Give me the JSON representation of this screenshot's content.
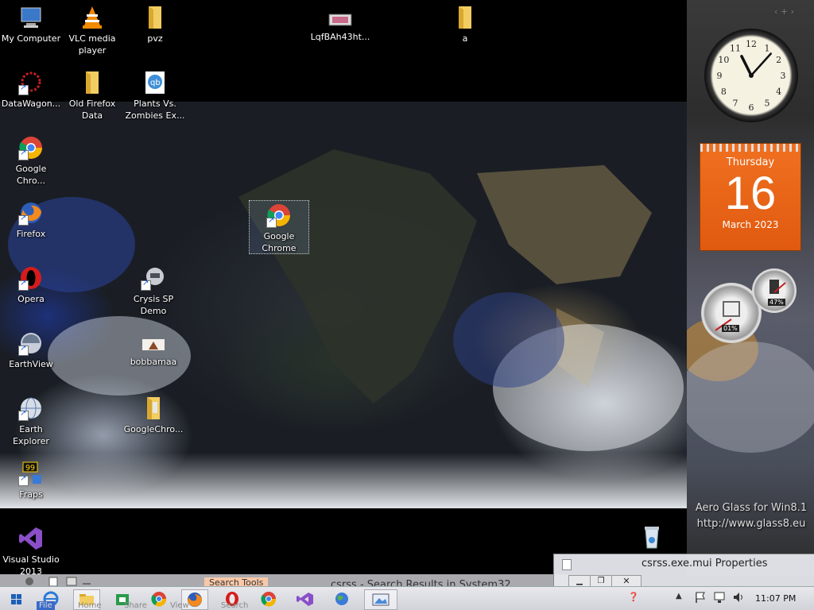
{
  "desktop_icons": [
    {
      "label": "My Computer",
      "icon": "computer-icon"
    },
    {
      "label": "VLC media player",
      "icon": "vlc-icon"
    },
    {
      "label": "pvz",
      "icon": "folder-icon"
    },
    {
      "label": "LqfBAh43ht...",
      "icon": "image-file-icon"
    },
    {
      "label": "a",
      "icon": "folder-icon"
    },
    {
      "label": "DataWagon...",
      "icon": "app-icon"
    },
    {
      "label": "Old Firefox Data",
      "icon": "folder-icon"
    },
    {
      "label": "Plants Vs. Zombies Ex...",
      "icon": "qbittorrent-icon"
    },
    {
      "label": "Google Chro...",
      "icon": "chrome-icon"
    },
    {
      "label": "Firefox",
      "icon": "firefox-icon"
    },
    {
      "label": "Opera",
      "icon": "opera-icon"
    },
    {
      "label": "EarthView",
      "icon": "earthview-icon"
    },
    {
      "label": "Earth Explorer",
      "icon": "earth-explorer-icon"
    },
    {
      "label": "Fraps",
      "icon": "fraps-icon"
    },
    {
      "label": "Visual Studio 2013",
      "icon": "visual-studio-icon"
    },
    {
      "label": "Google Chrome",
      "icon": "chrome-icon"
    },
    {
      "label": "Crysis SP Demo",
      "icon": "crysis-icon"
    },
    {
      "label": "bobbamaa",
      "icon": "image-file-icon"
    },
    {
      "label": "GoogleChro...",
      "icon": "folder-icon"
    },
    {
      "label": "",
      "icon": "recycle-bin-icon"
    }
  ],
  "gadgets": {
    "clock": {
      "numerals": [
        "12",
        "1",
        "2",
        "3",
        "4",
        "5",
        "6",
        "7",
        "8",
        "9",
        "10",
        "11"
      ],
      "hour": 11,
      "minute": 7
    },
    "calendar": {
      "weekday": "Thursday",
      "day": "16",
      "month_year": "March 2023"
    },
    "meters": {
      "cpu": "01%",
      "memory": "47%"
    }
  },
  "aero_text": {
    "line1": "Aero Glass for Win8.1",
    "line2": "http://www.glass8.eu"
  },
  "explorer_window": {
    "title": "csrss - Search Results in System32",
    "ribbon_tabs": [
      "File",
      "Home",
      "Share",
      "View",
      "Search"
    ],
    "contextual_tab": "Search Tools"
  },
  "properties_window": {
    "title": "csrss.exe.mui Properties"
  },
  "taskbar": {
    "pinned": [
      "start-icon",
      "ie-icon",
      "explorer-icon",
      "store-icon",
      "chrome-icon",
      "firefox-icon",
      "opera-icon",
      "chrome-icon",
      "visual-studio-icon",
      "earth-icon",
      "photos-icon"
    ],
    "time": "11:07 PM"
  },
  "colors": {
    "calendar_orange": "#e8661a",
    "taskbar": "#d9dbe0"
  }
}
